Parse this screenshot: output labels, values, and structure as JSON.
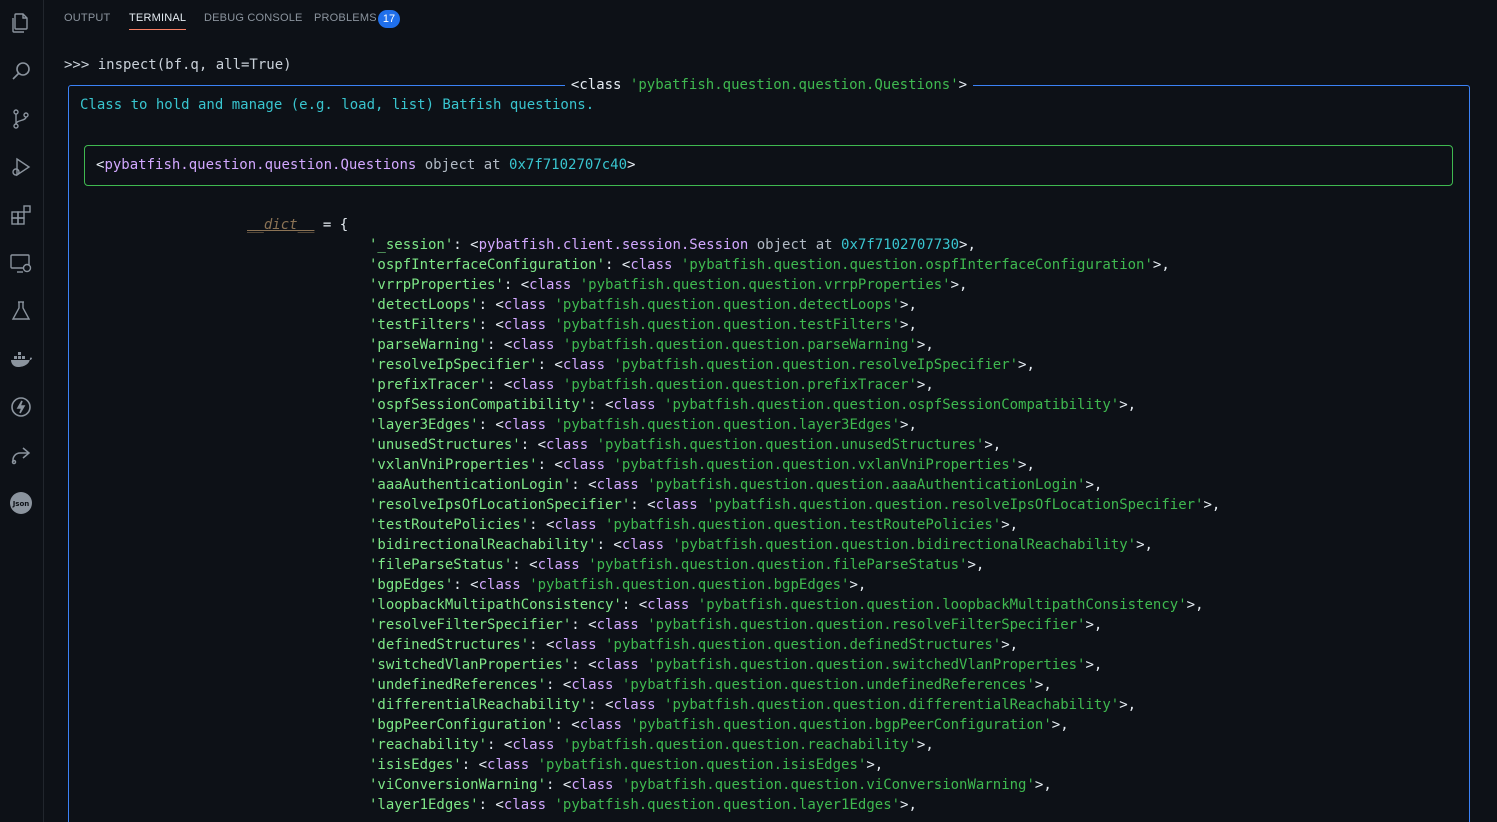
{
  "tabs": {
    "output": "OUTPUT",
    "terminal": "TERMINAL",
    "debug_console": "DEBUG CONSOLE",
    "problems": "PROBLEMS",
    "problems_count": "17"
  },
  "activity_icons": [
    "explorer-icon",
    "search-icon",
    "source-control-icon",
    "run-debug-icon",
    "extensions-icon",
    "remote-explorer-icon",
    "testing-icon",
    "docker-icon",
    "thunder-client-icon",
    "live-share-icon",
    "json-icon"
  ],
  "terminal": {
    "prompt": ">>> inspect(bf.q, all=True)",
    "panel_title_prefix": "<class ",
    "panel_title_value": "'pybatfish.question.question.Questions'",
    "panel_title_suffix": ">",
    "doc": "Class to hold and manage (e.g. load, list) Batfish questions.",
    "object_repr": {
      "open": "<",
      "name": "pybatfish.question.question.Questions",
      "middle": " object at ",
      "address": "0x7f7102707c40",
      "close": ">"
    },
    "dict_name": "__dict__",
    "dict_eq": " = {",
    "session_entry": {
      "key": "'_session'",
      "sep": ": <",
      "name": "pybatfish.client.session.Session",
      "middle": " object at ",
      "address": "0x7f7102707730",
      "close": ">,"
    },
    "entries": [
      {
        "key": "'ospfInterfaceConfiguration'",
        "value": "'pybatfish.question.question.ospfInterfaceConfiguration'"
      },
      {
        "key": "'vrrpProperties'",
        "value": "'pybatfish.question.question.vrrpProperties'"
      },
      {
        "key": "'detectLoops'",
        "value": "'pybatfish.question.question.detectLoops'"
      },
      {
        "key": "'testFilters'",
        "value": "'pybatfish.question.question.testFilters'"
      },
      {
        "key": "'parseWarning'",
        "value": "'pybatfish.question.question.parseWarning'"
      },
      {
        "key": "'resolveIpSpecifier'",
        "value": "'pybatfish.question.question.resolveIpSpecifier'"
      },
      {
        "key": "'prefixTracer'",
        "value": "'pybatfish.question.question.prefixTracer'"
      },
      {
        "key": "'ospfSessionCompatibility'",
        "value": "'pybatfish.question.question.ospfSessionCompatibility'"
      },
      {
        "key": "'layer3Edges'",
        "value": "'pybatfish.question.question.layer3Edges'"
      },
      {
        "key": "'unusedStructures'",
        "value": "'pybatfish.question.question.unusedStructures'"
      },
      {
        "key": "'vxlanVniProperties'",
        "value": "'pybatfish.question.question.vxlanVniProperties'"
      },
      {
        "key": "'aaaAuthenticationLogin'",
        "value": "'pybatfish.question.question.aaaAuthenticationLogin'"
      },
      {
        "key": "'resolveIpsOfLocationSpecifier'",
        "value": "'pybatfish.question.question.resolveIpsOfLocationSpecifier'"
      },
      {
        "key": "'testRoutePolicies'",
        "value": "'pybatfish.question.question.testRoutePolicies'"
      },
      {
        "key": "'bidirectionalReachability'",
        "value": "'pybatfish.question.question.bidirectionalReachability'"
      },
      {
        "key": "'fileParseStatus'",
        "value": "'pybatfish.question.question.fileParseStatus'"
      },
      {
        "key": "'bgpEdges'",
        "value": "'pybatfish.question.question.bgpEdges'"
      },
      {
        "key": "'loopbackMultipathConsistency'",
        "value": "'pybatfish.question.question.loopbackMultipathConsistency'"
      },
      {
        "key": "'resolveFilterSpecifier'",
        "value": "'pybatfish.question.question.resolveFilterSpecifier'"
      },
      {
        "key": "'definedStructures'",
        "value": "'pybatfish.question.question.definedStructures'"
      },
      {
        "key": "'switchedVlanProperties'",
        "value": "'pybatfish.question.question.switchedVlanProperties'"
      },
      {
        "key": "'undefinedReferences'",
        "value": "'pybatfish.question.question.undefinedReferences'"
      },
      {
        "key": "'differentialReachability'",
        "value": "'pybatfish.question.question.differentialReachability'"
      },
      {
        "key": "'bgpPeerConfiguration'",
        "value": "'pybatfish.question.question.bgpPeerConfiguration'"
      },
      {
        "key": "'reachability'",
        "value": "'pybatfish.question.question.reachability'"
      },
      {
        "key": "'isisEdges'",
        "value": "'pybatfish.question.question.isisEdges'"
      },
      {
        "key": "'viConversionWarning'",
        "value": "'pybatfish.question.question.viConversionWarning'"
      },
      {
        "key": "'layer1Edges'",
        "value": "'pybatfish.question.question.layer1Edges'"
      }
    ],
    "entry_sep": ": <",
    "class_kw": "class",
    "entry_close": ">,"
  },
  "colors": {
    "background": "#0d1117",
    "panel_border": "#3b82f6",
    "object_border": "#3fb950",
    "string_green": "#3fb950",
    "class_purple": "#d2a8ff",
    "doc_cyan": "#39c5cf",
    "badge_blue": "#1f6feb"
  }
}
